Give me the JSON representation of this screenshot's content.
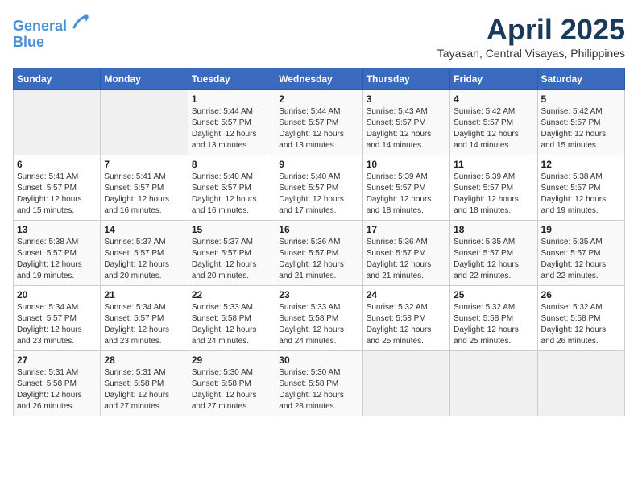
{
  "header": {
    "logo_line1": "General",
    "logo_line2": "Blue",
    "month": "April 2025",
    "location": "Tayasan, Central Visayas, Philippines"
  },
  "weekdays": [
    "Sunday",
    "Monday",
    "Tuesday",
    "Wednesday",
    "Thursday",
    "Friday",
    "Saturday"
  ],
  "weeks": [
    [
      {
        "day": "",
        "info": ""
      },
      {
        "day": "",
        "info": ""
      },
      {
        "day": "1",
        "info": "Sunrise: 5:44 AM\nSunset: 5:57 PM\nDaylight: 12 hours and 13 minutes."
      },
      {
        "day": "2",
        "info": "Sunrise: 5:44 AM\nSunset: 5:57 PM\nDaylight: 12 hours and 13 minutes."
      },
      {
        "day": "3",
        "info": "Sunrise: 5:43 AM\nSunset: 5:57 PM\nDaylight: 12 hours and 14 minutes."
      },
      {
        "day": "4",
        "info": "Sunrise: 5:42 AM\nSunset: 5:57 PM\nDaylight: 12 hours and 14 minutes."
      },
      {
        "day": "5",
        "info": "Sunrise: 5:42 AM\nSunset: 5:57 PM\nDaylight: 12 hours and 15 minutes."
      }
    ],
    [
      {
        "day": "6",
        "info": "Sunrise: 5:41 AM\nSunset: 5:57 PM\nDaylight: 12 hours and 15 minutes."
      },
      {
        "day": "7",
        "info": "Sunrise: 5:41 AM\nSunset: 5:57 PM\nDaylight: 12 hours and 16 minutes."
      },
      {
        "day": "8",
        "info": "Sunrise: 5:40 AM\nSunset: 5:57 PM\nDaylight: 12 hours and 16 minutes."
      },
      {
        "day": "9",
        "info": "Sunrise: 5:40 AM\nSunset: 5:57 PM\nDaylight: 12 hours and 17 minutes."
      },
      {
        "day": "10",
        "info": "Sunrise: 5:39 AM\nSunset: 5:57 PM\nDaylight: 12 hours and 18 minutes."
      },
      {
        "day": "11",
        "info": "Sunrise: 5:39 AM\nSunset: 5:57 PM\nDaylight: 12 hours and 18 minutes."
      },
      {
        "day": "12",
        "info": "Sunrise: 5:38 AM\nSunset: 5:57 PM\nDaylight: 12 hours and 19 minutes."
      }
    ],
    [
      {
        "day": "13",
        "info": "Sunrise: 5:38 AM\nSunset: 5:57 PM\nDaylight: 12 hours and 19 minutes."
      },
      {
        "day": "14",
        "info": "Sunrise: 5:37 AM\nSunset: 5:57 PM\nDaylight: 12 hours and 20 minutes."
      },
      {
        "day": "15",
        "info": "Sunrise: 5:37 AM\nSunset: 5:57 PM\nDaylight: 12 hours and 20 minutes."
      },
      {
        "day": "16",
        "info": "Sunrise: 5:36 AM\nSunset: 5:57 PM\nDaylight: 12 hours and 21 minutes."
      },
      {
        "day": "17",
        "info": "Sunrise: 5:36 AM\nSunset: 5:57 PM\nDaylight: 12 hours and 21 minutes."
      },
      {
        "day": "18",
        "info": "Sunrise: 5:35 AM\nSunset: 5:57 PM\nDaylight: 12 hours and 22 minutes."
      },
      {
        "day": "19",
        "info": "Sunrise: 5:35 AM\nSunset: 5:57 PM\nDaylight: 12 hours and 22 minutes."
      }
    ],
    [
      {
        "day": "20",
        "info": "Sunrise: 5:34 AM\nSunset: 5:57 PM\nDaylight: 12 hours and 23 minutes."
      },
      {
        "day": "21",
        "info": "Sunrise: 5:34 AM\nSunset: 5:57 PM\nDaylight: 12 hours and 23 minutes."
      },
      {
        "day": "22",
        "info": "Sunrise: 5:33 AM\nSunset: 5:58 PM\nDaylight: 12 hours and 24 minutes."
      },
      {
        "day": "23",
        "info": "Sunrise: 5:33 AM\nSunset: 5:58 PM\nDaylight: 12 hours and 24 minutes."
      },
      {
        "day": "24",
        "info": "Sunrise: 5:32 AM\nSunset: 5:58 PM\nDaylight: 12 hours and 25 minutes."
      },
      {
        "day": "25",
        "info": "Sunrise: 5:32 AM\nSunset: 5:58 PM\nDaylight: 12 hours and 25 minutes."
      },
      {
        "day": "26",
        "info": "Sunrise: 5:32 AM\nSunset: 5:58 PM\nDaylight: 12 hours and 26 minutes."
      }
    ],
    [
      {
        "day": "27",
        "info": "Sunrise: 5:31 AM\nSunset: 5:58 PM\nDaylight: 12 hours and 26 minutes."
      },
      {
        "day": "28",
        "info": "Sunrise: 5:31 AM\nSunset: 5:58 PM\nDaylight: 12 hours and 27 minutes."
      },
      {
        "day": "29",
        "info": "Sunrise: 5:30 AM\nSunset: 5:58 PM\nDaylight: 12 hours and 27 minutes."
      },
      {
        "day": "30",
        "info": "Sunrise: 5:30 AM\nSunset: 5:58 PM\nDaylight: 12 hours and 28 minutes."
      },
      {
        "day": "",
        "info": ""
      },
      {
        "day": "",
        "info": ""
      },
      {
        "day": "",
        "info": ""
      }
    ]
  ]
}
